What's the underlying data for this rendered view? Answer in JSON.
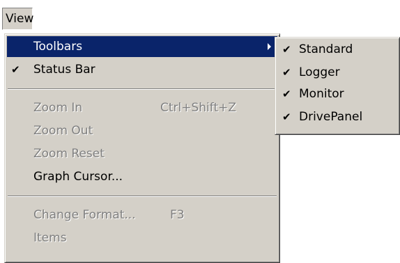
{
  "menubar": {
    "view_label": "View"
  },
  "menu": {
    "items": [
      {
        "label": "Toolbars",
        "shortcut": "",
        "checked": false,
        "enabled": true,
        "has_submenu": true,
        "highlighted": true
      },
      {
        "label": "Status Bar",
        "shortcut": "",
        "checked": true,
        "enabled": true
      },
      {
        "label": "Zoom In",
        "shortcut": "Ctrl+Shift+Z",
        "checked": false,
        "enabled": false
      },
      {
        "label": "Zoom Out",
        "shortcut": "",
        "checked": false,
        "enabled": false
      },
      {
        "label": "Zoom Reset",
        "shortcut": "",
        "checked": false,
        "enabled": false
      },
      {
        "label": "Graph Cursor...",
        "shortcut": "",
        "checked": false,
        "enabled": true
      },
      {
        "label": "Change Format...",
        "shortcut": "F3",
        "checked": false,
        "enabled": false
      },
      {
        "label": "Items",
        "shortcut": "",
        "checked": false,
        "enabled": false
      }
    ]
  },
  "submenu": {
    "items": [
      {
        "label": "Standard",
        "checked": true
      },
      {
        "label": "Logger",
        "checked": true
      },
      {
        "label": "Monitor",
        "checked": true
      },
      {
        "label": "DrivePanel",
        "checked": true
      }
    ]
  },
  "icons": {
    "check": "✔",
    "submenu_arrow": "triangle-right"
  },
  "colors": {
    "menu_background": "#d4d0c8",
    "highlight_background": "#0a246a",
    "highlight_text": "#ffffff",
    "disabled_text": "#808080"
  }
}
